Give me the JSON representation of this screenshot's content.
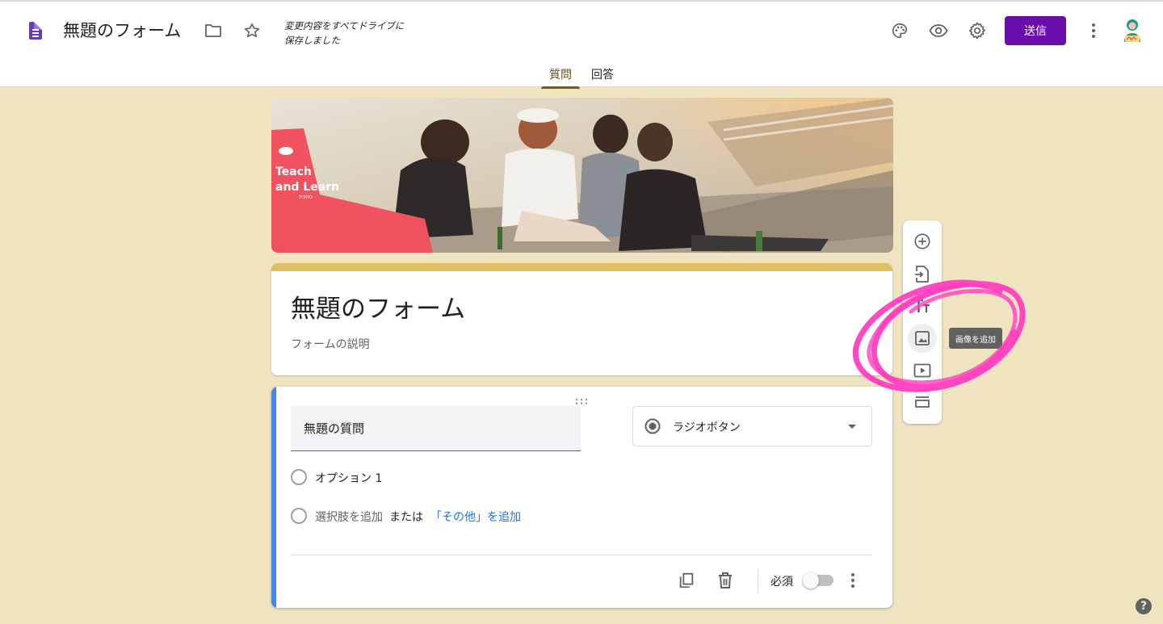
{
  "header": {
    "title": "無題のフォーム",
    "saved_status": "変更内容をすべてドライブに\n保存しました",
    "saved_line1": "変更内容をすべてドライブに",
    "saved_line2": "保存しました",
    "send_label": "送信",
    "icons": [
      "forms-logo-icon",
      "folder-icon",
      "star-icon",
      "palette-icon",
      "eye-icon",
      "gear-icon",
      "more-vert-icon"
    ]
  },
  "tabs": [
    {
      "label": "質問",
      "active": true
    },
    {
      "label": "回答",
      "active": false
    }
  ],
  "banner": {
    "logo_line1": "Teach",
    "logo_line2": "and Learn",
    "logo_sub": "TOKYO",
    "accent_color": "#f0525f"
  },
  "form": {
    "title": "無題のフォーム",
    "description_placeholder": "フォームの説明",
    "theme_color": "#dfbf5f"
  },
  "question": {
    "title": "無題の質問",
    "type_label": "ラジオボタン",
    "options": [
      "オプション 1"
    ],
    "add_option": "選択肢を追加",
    "or_text": "または",
    "add_other": "「その他」を追加",
    "required_label": "必須",
    "required": false
  },
  "toolbar": {
    "items": [
      "add-question",
      "import-questions",
      "add-title",
      "add-image",
      "add-video",
      "add-section"
    ],
    "tooltip": "画像を追加"
  },
  "help_label": "?",
  "colors": {
    "background": "#efe3c0",
    "primary": "#6a0dad",
    "link": "#1a73e8",
    "annotation": "#ff3fbf"
  }
}
